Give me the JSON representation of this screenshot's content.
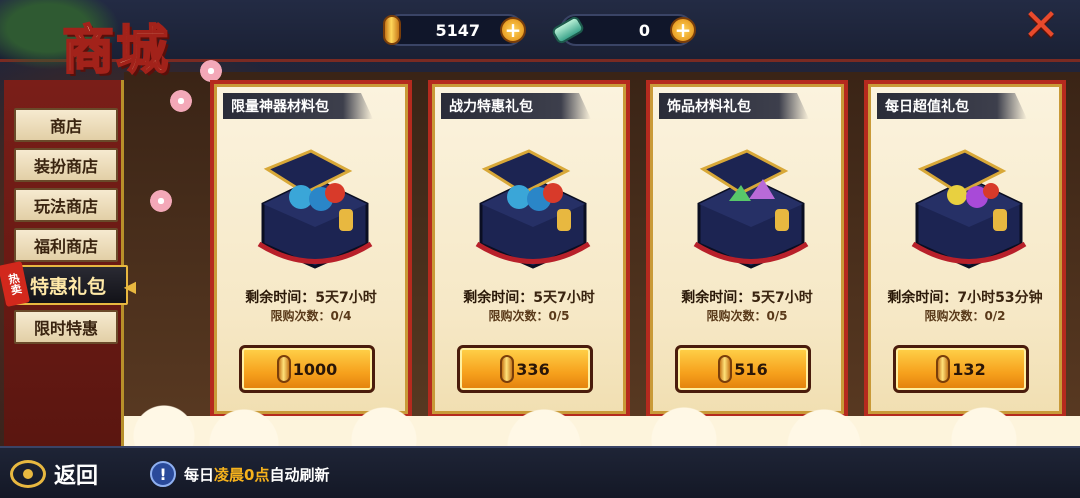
{
  "title": "商城",
  "currency": {
    "coins": {
      "icon": "gold-bar-icon",
      "value": "5147"
    },
    "jade": {
      "icon": "jade-icon",
      "value": "0"
    }
  },
  "nav": {
    "items": [
      {
        "label": "商店",
        "active": false
      },
      {
        "label": "装扮商店",
        "active": false
      },
      {
        "label": "玩法商店",
        "active": false
      },
      {
        "label": "福利商店",
        "active": false
      },
      {
        "label": "特惠礼包",
        "active": true,
        "badge": "热卖"
      },
      {
        "label": "限时特惠",
        "active": false
      }
    ]
  },
  "packs": [
    {
      "name": "限量神器材料包",
      "timer_label": "剩余时间：",
      "timer_value": "5天7小时",
      "limit": "限购次数：0/4",
      "price": "1000"
    },
    {
      "name": "战力特惠礼包",
      "timer_label": "剩余时间：",
      "timer_value": "5天7小时",
      "limit": "限购次数：0/5",
      "price": "336"
    },
    {
      "name": "饰品材料礼包",
      "timer_label": "剩余时间：",
      "timer_value": "5天7小时",
      "limit": "限购次数：0/5",
      "price": "516"
    },
    {
      "name": "每日超值礼包",
      "timer_label": "剩余时间：",
      "timer_value": "7小时53分钟",
      "limit": "限购次数：0/2",
      "price": "132"
    }
  ],
  "bottom": {
    "back_label": "返回",
    "note_prefix": "每日",
    "note_highlight": "凌晨0点",
    "note_suffix": "自动刷新"
  },
  "colors": {
    "accent_gold": "#f6b21c",
    "accent_red": "#b52a1e"
  }
}
